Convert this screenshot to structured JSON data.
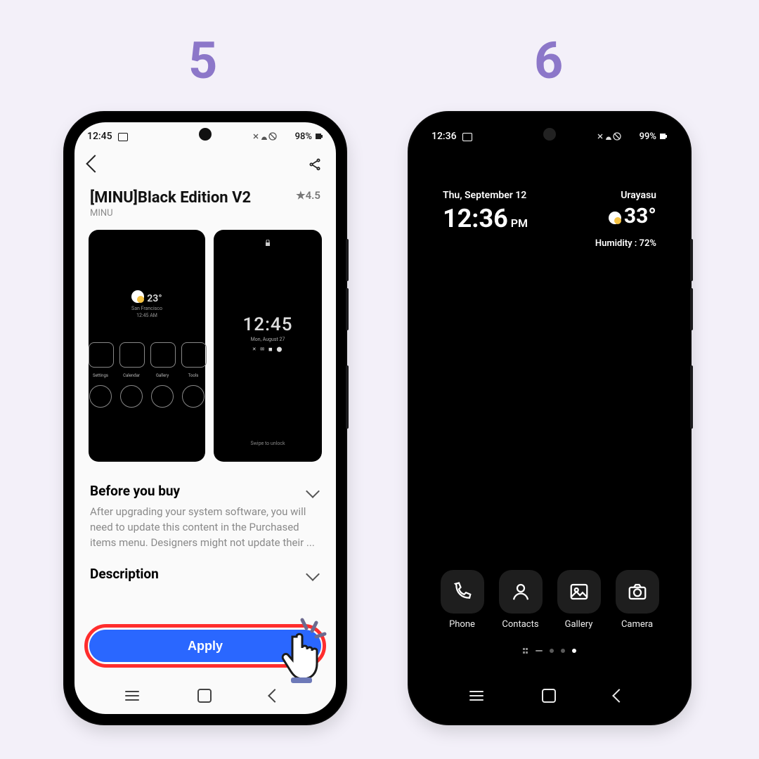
{
  "steps": {
    "a": "5",
    "b": "6"
  },
  "p1": {
    "status": {
      "time": "12:45",
      "battery": "98%"
    },
    "title": "[MINU]Black Edition V2",
    "vendor": "MINU",
    "rating": "4.5",
    "shot1": {
      "temp": "23°",
      "city": "San Francisco",
      "clock": "12:45 AM",
      "icons": [
        "Settings",
        "Calendar",
        "Gallery",
        "Tools"
      ]
    },
    "shot2": {
      "clock": "12:45",
      "date": "Mon, August 27",
      "swipe": "Swipe to unlock"
    },
    "before_head": "Before you buy",
    "before_body": "After upgrading your system software, you will need to update this content in the Purchased items menu. Designers might not update their ...",
    "desc_head": "Description",
    "apply": "Apply"
  },
  "p2": {
    "status": {
      "time": "12:36",
      "battery": "99%"
    },
    "date": "Thu, September 12",
    "time": "12:36",
    "ampm": "PM",
    "location": "Urayasu",
    "temp": "33°",
    "humidity": "Humidity : 72%",
    "dock": [
      "Phone",
      "Contacts",
      "Gallery",
      "Camera"
    ]
  }
}
